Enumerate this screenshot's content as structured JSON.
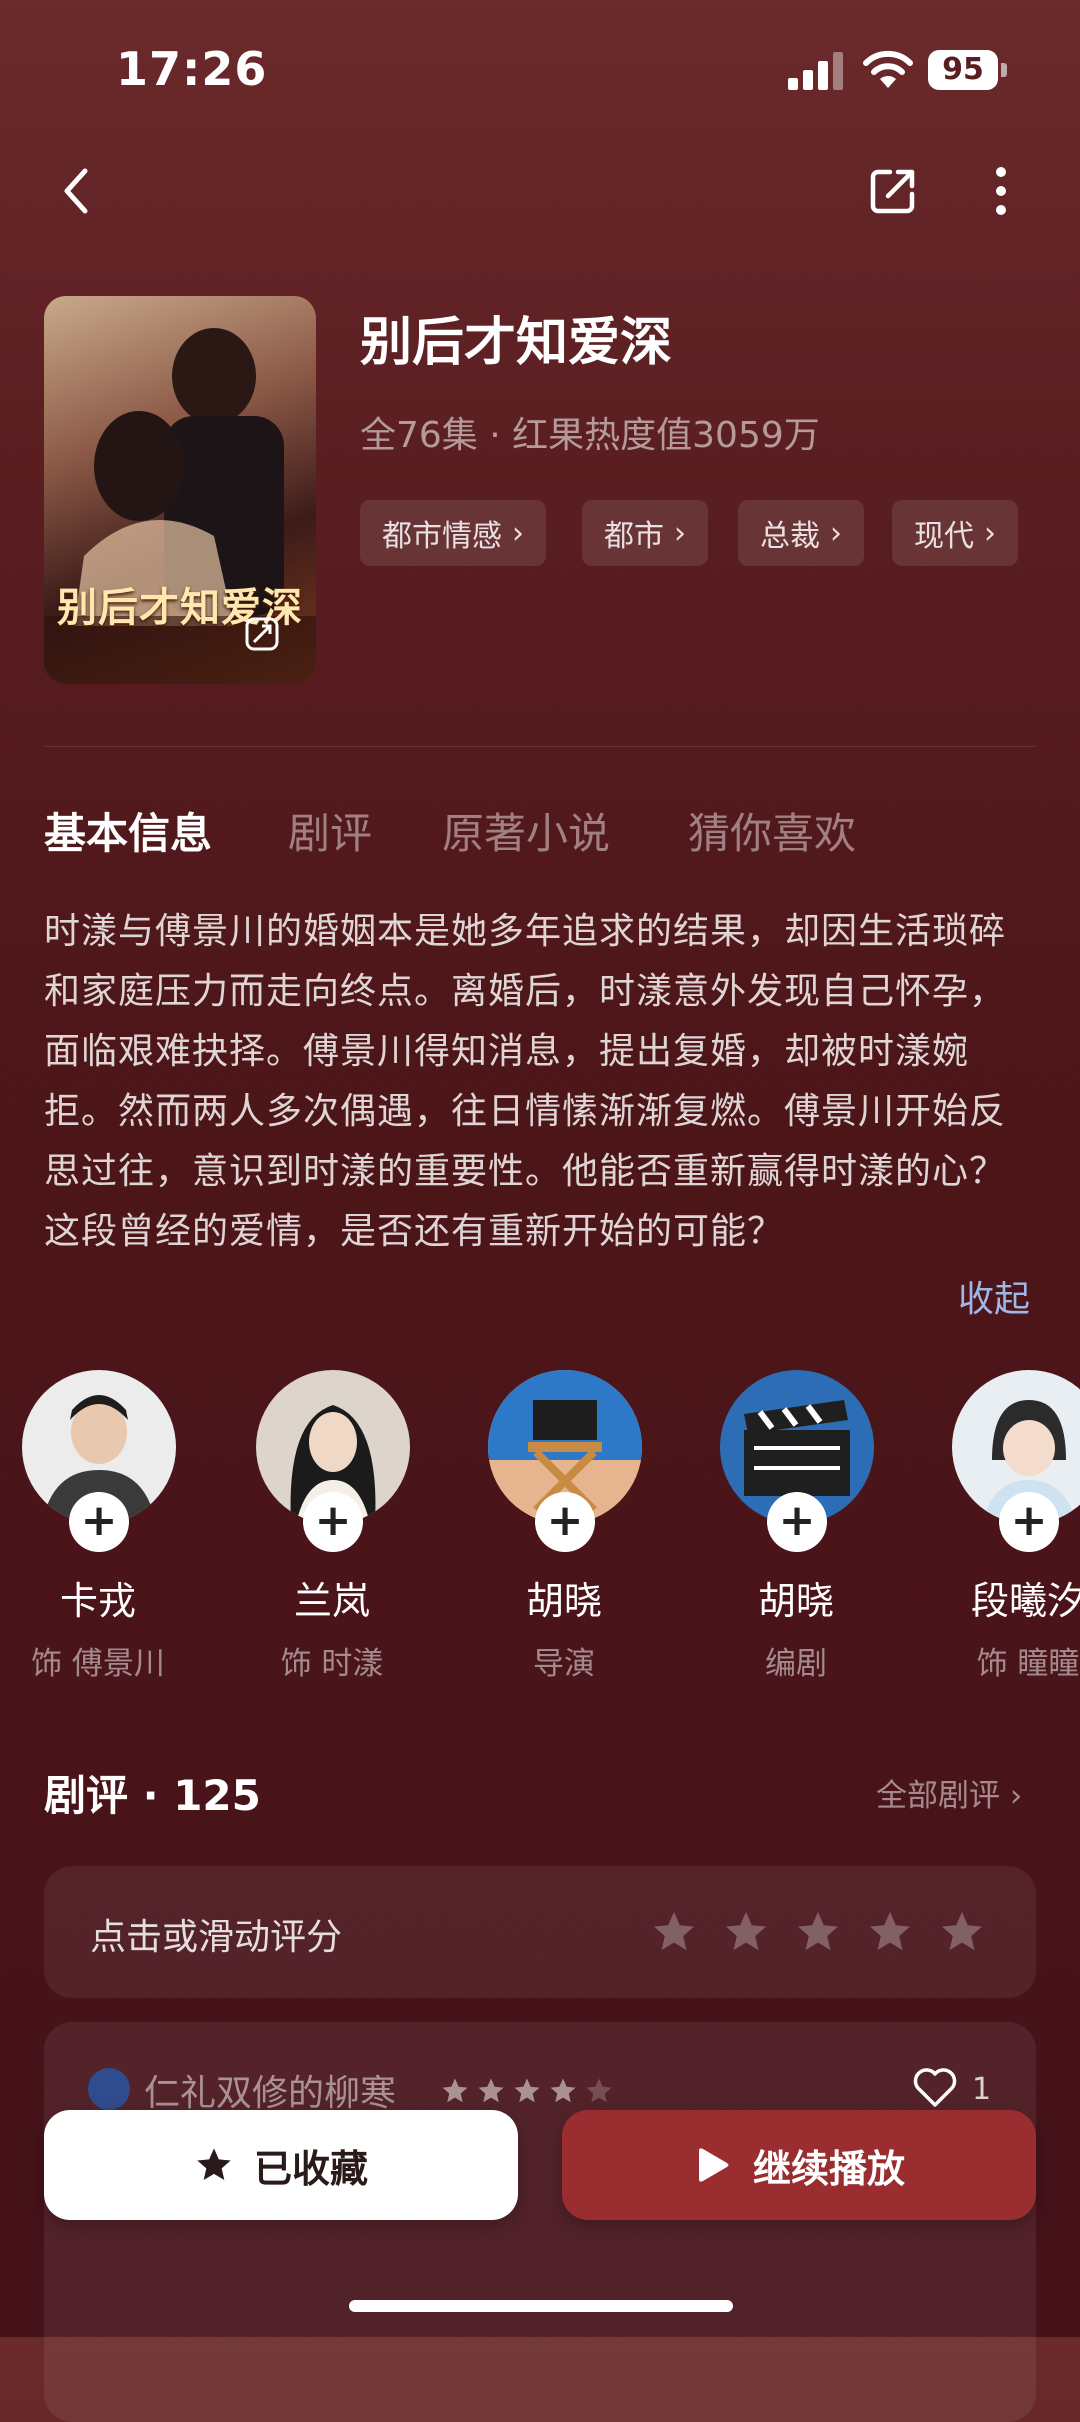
{
  "status_bar": {
    "time": "17:26",
    "battery": "95"
  },
  "show": {
    "title": "别后才知爱深",
    "poster_title": "别后才知爱深",
    "meta": "全76集 · 红果热度值3059万",
    "tags": [
      "都市情感",
      "都市",
      "总裁",
      "现代"
    ]
  },
  "tabs": [
    "基本信息",
    "剧评",
    "原著小说",
    "猜你喜欢"
  ],
  "description": "时漾与傅景川的婚姻本是她多年追求的结果，却因生活琐碎和家庭压力而走向终点。离婚后，时漾意外发现自己怀孕，面临艰难抉择。傅景川得知消息，提出复婚，却被时漾婉拒。然而两人多次偶遇，往日情愫渐渐复燃。傅景川开始反思过往，意识到时漾的重要性。他能否重新赢得时漾的心？这段曾经的爱情，是否还有重新开始的可能？",
  "collapse_label": "收起",
  "cast": [
    {
      "name": "卡戎",
      "role": "饰 傅景川"
    },
    {
      "name": "兰岚",
      "role": "饰 时漾"
    },
    {
      "name": "胡晓",
      "role": "导演"
    },
    {
      "name": "胡晓",
      "role": "编剧"
    },
    {
      "name": "段曦汐",
      "role": "饰 瞳瞳"
    }
  ],
  "reviews": {
    "title": "剧评 · 125",
    "all_label": "全部剧评 ›",
    "rate_prompt": "点击或滑动评分",
    "comment": {
      "user": "仁礼双修的柳寒",
      "stars": 4,
      "likes": "1"
    }
  },
  "buttons": {
    "favorite": "已收藏",
    "play": "继续播放"
  },
  "colors": {
    "accent": "#9a2d30",
    "link": "#9fb7e6"
  }
}
